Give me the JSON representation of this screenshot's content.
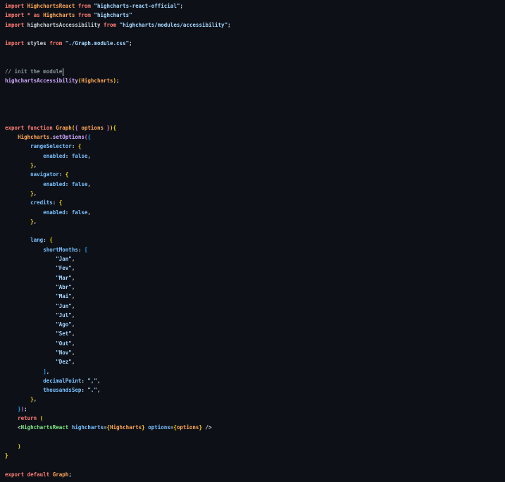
{
  "editor": {
    "language": "javascript-react",
    "colors": {
      "background": "#0d1117",
      "foreground": "#c9d1d9",
      "keyword": "#ff7b72",
      "identifier": "#ffa657",
      "string": "#a5d6ff",
      "property": "#79c0ff",
      "constant": "#79c0ff",
      "function": "#d2a8ff",
      "jsx_tag": "#7ee787",
      "jsx_attribute": "#79c0ff",
      "comment": "#8b949e",
      "bracket_gold": "#ffd700",
      "bracket_orchid": "#da70d6",
      "bracket_blue": "#179fff",
      "caret": "#e6edf3"
    },
    "cursor": {
      "line_index": 7,
      "after_text": "// init the module"
    },
    "lines": [
      [
        [
          "kw",
          "import "
        ],
        [
          "id",
          "HighchartsReact "
        ],
        [
          "kw",
          "from "
        ],
        [
          "str",
          "\"highcharts-react-official\""
        ],
        [
          "fg",
          ";"
        ]
      ],
      [
        [
          "kw",
          "import * as "
        ],
        [
          "id",
          "Highcharts "
        ],
        [
          "kw",
          "from "
        ],
        [
          "str",
          "\"highcharts\""
        ]
      ],
      [
        [
          "kw",
          "import "
        ],
        [
          "fg",
          "highchartsAccessibility "
        ],
        [
          "kw",
          "from "
        ],
        [
          "str",
          "\"highcharts/modules/accessibility\""
        ],
        [
          "fg",
          ";"
        ]
      ],
      [],
      [
        [
          "kw",
          "import "
        ],
        [
          "fg",
          "styles "
        ],
        [
          "kw",
          "from "
        ],
        [
          "str",
          "\"./Graph.module.css\""
        ],
        [
          "fg",
          ";"
        ]
      ],
      [],
      [],
      [
        [
          "cmt",
          "// init the module"
        ],
        [
          "caret",
          ""
        ]
      ],
      [
        [
          "fn",
          "highchartsAccessibility"
        ],
        [
          "b1",
          "("
        ],
        [
          "id",
          "Highcharts"
        ],
        [
          "b1",
          ")"
        ],
        [
          "fg",
          ";"
        ]
      ],
      [],
      [],
      [],
      [],
      [
        [
          "kw",
          "export function "
        ],
        [
          "id",
          "Graph"
        ],
        [
          "b1",
          "("
        ],
        [
          "b2",
          "{"
        ],
        [
          "id",
          " options "
        ],
        [
          "b2",
          "}"
        ],
        [
          "b1",
          ")"
        ],
        [
          "b1",
          "{"
        ]
      ],
      [
        [
          "fg",
          "    "
        ],
        [
          "id",
          "Highcharts"
        ],
        [
          "fg",
          "."
        ],
        [
          "fn",
          "setOptions"
        ],
        [
          "b2",
          "("
        ],
        [
          "b3",
          "{"
        ]
      ],
      [
        [
          "fg",
          "        "
        ],
        [
          "prop",
          "rangeSelector"
        ],
        [
          "fg",
          ": "
        ],
        [
          "b1",
          "{"
        ]
      ],
      [
        [
          "fg",
          "            "
        ],
        [
          "prop",
          "enabled"
        ],
        [
          "fg",
          ": "
        ],
        [
          "const",
          "false"
        ],
        [
          "fg",
          ","
        ]
      ],
      [
        [
          "fg",
          "        "
        ],
        [
          "b1",
          "}"
        ],
        [
          "fg",
          ","
        ]
      ],
      [
        [
          "fg",
          "        "
        ],
        [
          "prop",
          "navigator"
        ],
        [
          "fg",
          ": "
        ],
        [
          "b1",
          "{"
        ]
      ],
      [
        [
          "fg",
          "            "
        ],
        [
          "prop",
          "enabled"
        ],
        [
          "fg",
          ": "
        ],
        [
          "const",
          "false"
        ],
        [
          "fg",
          ","
        ]
      ],
      [
        [
          "fg",
          "        "
        ],
        [
          "b1",
          "}"
        ],
        [
          "fg",
          ","
        ]
      ],
      [
        [
          "fg",
          "        "
        ],
        [
          "prop",
          "credits"
        ],
        [
          "fg",
          ": "
        ],
        [
          "b1",
          "{"
        ]
      ],
      [
        [
          "fg",
          "            "
        ],
        [
          "prop",
          "enabled"
        ],
        [
          "fg",
          ": "
        ],
        [
          "const",
          "false"
        ],
        [
          "fg",
          ","
        ]
      ],
      [
        [
          "fg",
          "        "
        ],
        [
          "b1",
          "}"
        ],
        [
          "fg",
          ","
        ]
      ],
      [],
      [
        [
          "fg",
          "        "
        ],
        [
          "prop",
          "lang"
        ],
        [
          "fg",
          ": "
        ],
        [
          "b1",
          "{"
        ]
      ],
      [
        [
          "fg",
          "            "
        ],
        [
          "prop",
          "shortMonths"
        ],
        [
          "fg",
          ": "
        ],
        [
          "b3",
          "["
        ]
      ],
      [
        [
          "fg",
          "                "
        ],
        [
          "str",
          "\"Jan\""
        ],
        [
          "fg",
          ","
        ]
      ],
      [
        [
          "fg",
          "                "
        ],
        [
          "str",
          "\"Fev\""
        ],
        [
          "fg",
          ","
        ]
      ],
      [
        [
          "fg",
          "                "
        ],
        [
          "str",
          "\"Mar\""
        ],
        [
          "fg",
          ","
        ]
      ],
      [
        [
          "fg",
          "                "
        ],
        [
          "str",
          "\"Abr\""
        ],
        [
          "fg",
          ","
        ]
      ],
      [
        [
          "fg",
          "                "
        ],
        [
          "str",
          "\"Mai\""
        ],
        [
          "fg",
          ","
        ]
      ],
      [
        [
          "fg",
          "                "
        ],
        [
          "str",
          "\"Jun\""
        ],
        [
          "fg",
          ","
        ]
      ],
      [
        [
          "fg",
          "                "
        ],
        [
          "str",
          "\"Jul\""
        ],
        [
          "fg",
          ","
        ]
      ],
      [
        [
          "fg",
          "                "
        ],
        [
          "str",
          "\"Ago\""
        ],
        [
          "fg",
          ","
        ]
      ],
      [
        [
          "fg",
          "                "
        ],
        [
          "str",
          "\"Set\""
        ],
        [
          "fg",
          ","
        ]
      ],
      [
        [
          "fg",
          "                "
        ],
        [
          "str",
          "\"Out\""
        ],
        [
          "fg",
          ","
        ]
      ],
      [
        [
          "fg",
          "                "
        ],
        [
          "str",
          "\"Nov\""
        ],
        [
          "fg",
          ","
        ]
      ],
      [
        [
          "fg",
          "                "
        ],
        [
          "str",
          "\"Dez\""
        ],
        [
          "fg",
          ","
        ]
      ],
      [
        [
          "fg",
          "            "
        ],
        [
          "b3",
          "]"
        ],
        [
          "fg",
          ","
        ]
      ],
      [
        [
          "fg",
          "            "
        ],
        [
          "prop",
          "decimalPoint"
        ],
        [
          "fg",
          ": "
        ],
        [
          "str",
          "\",\""
        ],
        [
          "fg",
          ","
        ]
      ],
      [
        [
          "fg",
          "            "
        ],
        [
          "prop",
          "thousandsSep"
        ],
        [
          "fg",
          ": "
        ],
        [
          "str",
          "\".\""
        ],
        [
          "fg",
          ","
        ]
      ],
      [
        [
          "fg",
          "        "
        ],
        [
          "b1",
          "}"
        ],
        [
          "fg",
          ","
        ]
      ],
      [
        [
          "fg",
          "    "
        ],
        [
          "b3",
          "}"
        ],
        [
          "b2",
          ")"
        ],
        [
          "fg",
          ";"
        ]
      ],
      [
        [
          "fg",
          "    "
        ],
        [
          "kw",
          "return "
        ],
        [
          "b1",
          "("
        ]
      ],
      [
        [
          "fg",
          "    "
        ],
        [
          "fg",
          "<"
        ],
        [
          "tag",
          "HighchartsReact "
        ],
        [
          "attr",
          "highcharts"
        ],
        [
          "fg",
          "="
        ],
        [
          "b1",
          "{"
        ],
        [
          "id",
          "Highcharts"
        ],
        [
          "b1",
          "}"
        ],
        [
          "attr",
          " options"
        ],
        [
          "fg",
          "="
        ],
        [
          "b1",
          "{"
        ],
        [
          "id",
          "options"
        ],
        [
          "b1",
          "}"
        ],
        [
          "fg",
          " />"
        ]
      ],
      [],
      [
        [
          "fg",
          "    "
        ],
        [
          "b1",
          ")"
        ]
      ],
      [
        [
          "b1",
          "}"
        ]
      ],
      [],
      [
        [
          "kw",
          "export default "
        ],
        [
          "id",
          "Graph"
        ],
        [
          "fg",
          ";"
        ]
      ]
    ]
  }
}
